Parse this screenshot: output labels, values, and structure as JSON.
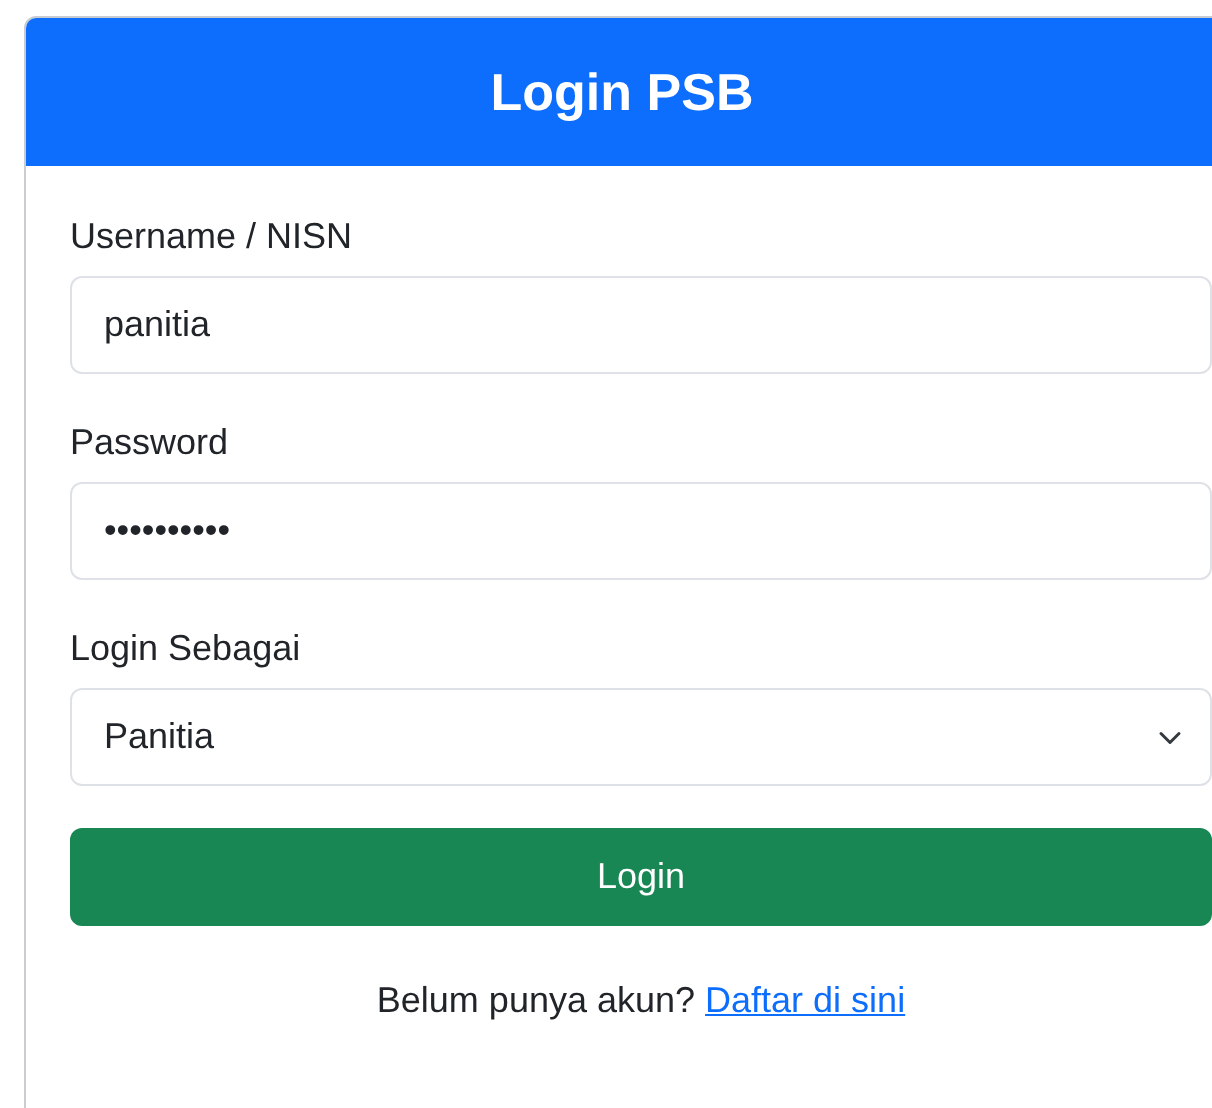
{
  "card": {
    "title": "Login PSB"
  },
  "fields": [
    {
      "kind": "text",
      "label": "Username / NISN",
      "value": "panitia"
    },
    {
      "kind": "text",
      "label": "Password",
      "value": "••••••••••"
    },
    {
      "kind": "select",
      "label": "Login Sebagai",
      "value": "Panitia"
    }
  ],
  "submit": "Login",
  "footer": {
    "text": "Belum punya akun?",
    "link": "Daftar di sini"
  }
}
